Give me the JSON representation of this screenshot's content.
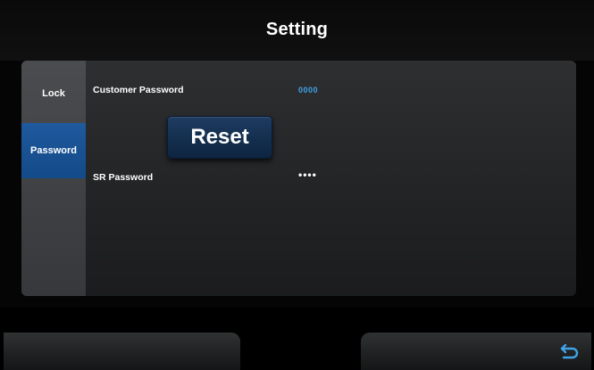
{
  "header": {
    "title": "Setting"
  },
  "sidebar": {
    "items": [
      {
        "label": "Lock",
        "selected": false
      },
      {
        "label": "Password",
        "selected": true
      }
    ]
  },
  "password_settings": {
    "customer_password_label": "Customer Password",
    "customer_password_value": "0000",
    "reset_label": "Reset",
    "sr_password_label": "SR Password",
    "sr_password_value": "••••"
  },
  "footer": {
    "back_icon": "back-arrow-icon"
  },
  "colors": {
    "accent_blue": "#3fa3e6",
    "selected_tab": "#1f5a9e",
    "reset_button": "#14304f"
  }
}
